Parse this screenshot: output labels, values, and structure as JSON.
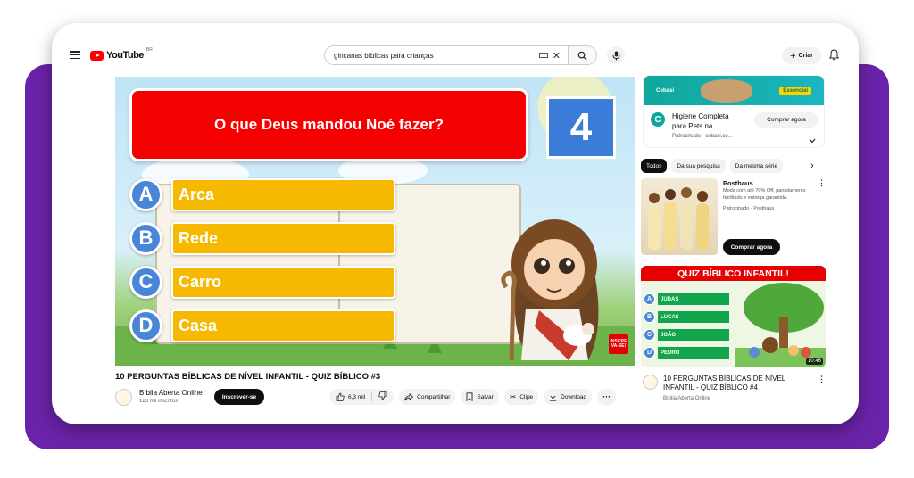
{
  "header": {
    "logo_text": "YouTube",
    "country_code": "BR",
    "search_value": "gincanas bíblicas para crianças",
    "create_label": "Criar"
  },
  "video": {
    "question": "O que Deus mandou Noé fazer?",
    "countdown": "4",
    "options": [
      {
        "letter": "A",
        "text": "Arca"
      },
      {
        "letter": "B",
        "text": "Rede"
      },
      {
        "letter": "C",
        "text": "Carro"
      },
      {
        "letter": "D",
        "text": "Casa"
      }
    ],
    "subscribe_badge": [
      "INSCRE",
      "VA-SE!"
    ],
    "title": "10 PERGUNTAS BÍBLICAS DE NÍVEL INFANTIL - QUIZ BÍBLICO #3",
    "channel_name": "Bíblia Aberta Online",
    "channel_subs": "123 mil inscritos",
    "subscribe_label": "Inscrever-se",
    "likes": "6,3 mil",
    "share_label": "Compartilhar",
    "save_label": "Salvar",
    "clip_label": "Clipe",
    "download_label": "Download"
  },
  "sidebar": {
    "ad1": {
      "banner_brand": "Cobasi",
      "banner_tag": "Essencial",
      "logo_letter": "C",
      "title": "Higiene Completa para Pets na...",
      "sponsor": "Patrocinado · cobasi.co...",
      "button": "Comprar agora"
    },
    "chips": [
      "Todos",
      "Da sua pesquisa",
      "Da mesma série"
    ],
    "ad2": {
      "title": "Posthaus",
      "desc": "Moda com até 70% Off, parcelamento facilitado e entrega garantida.",
      "sponsor": "Patrocinado · Posthaus",
      "button": "Comprar agora"
    },
    "next_video": {
      "thumb_header": "QUIZ BÍBLICO INFANTIL!",
      "options": [
        {
          "letter": "A",
          "text": "JUDAS"
        },
        {
          "letter": "B",
          "text": "LUCAS"
        },
        {
          "letter": "C",
          "text": "JOÃO"
        },
        {
          "letter": "D",
          "text": "PEDRO"
        }
      ],
      "duration": "10:46",
      "title": "10 PERGUNTAS BÍBLICAS DE NÍVEL INFANTIL - QUIZ BÍBLICO #4",
      "channel": "Bíblia Aberta Online"
    }
  }
}
